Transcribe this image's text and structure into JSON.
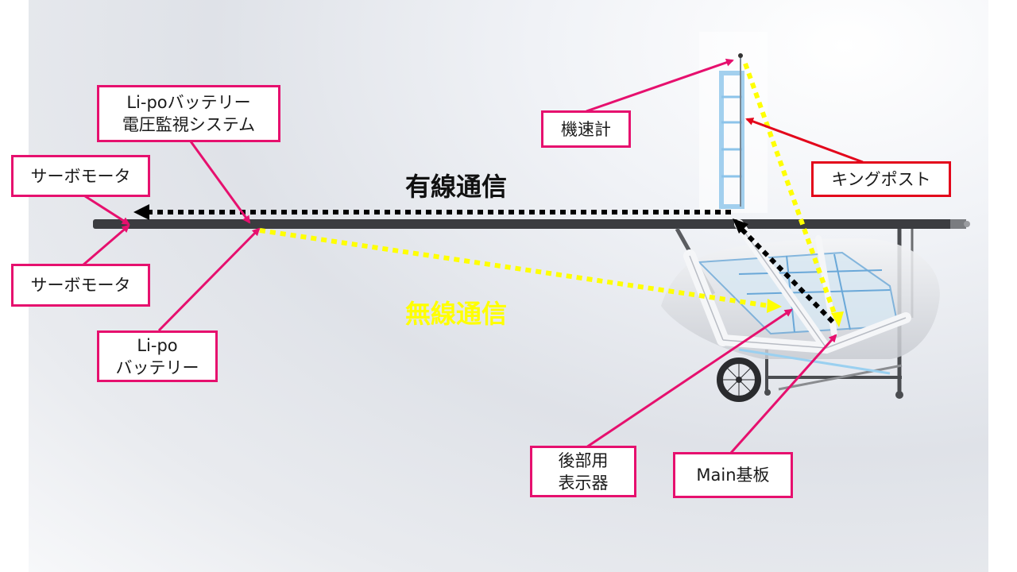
{
  "labels": {
    "servo_motor_top": "サーボモータ",
    "servo_motor_bottom": "サーボモータ",
    "lipo_monitor_line1": "Li-poバッテリー",
    "lipo_monitor_line2": "電圧監視システム",
    "lipo_battery_line1": "Li-po",
    "lipo_battery_line2": "バッテリー",
    "airspeed_meter": "機速計",
    "king_post": "キングポスト",
    "rear_display_line1": "後部用",
    "rear_display_line2": "表示器",
    "main_board": "Main基板",
    "wired_comm": "有線通信",
    "wireless_comm": "無線通信"
  },
  "colors": {
    "box_border": "#e6106e",
    "king_post_border": "#e3061b",
    "wired_arrow": "#000000",
    "wireless_arrow": "#ffff00",
    "wireless_text": "#ffff00",
    "wired_text": "#111111"
  }
}
